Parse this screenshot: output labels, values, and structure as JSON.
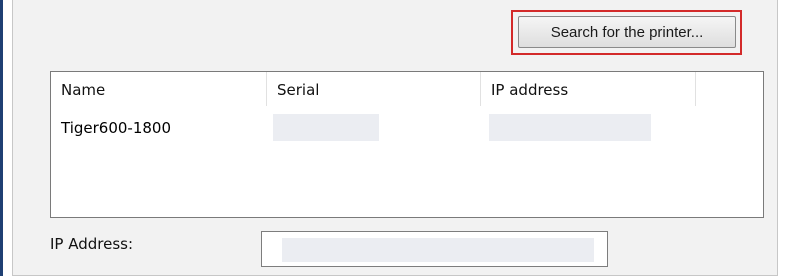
{
  "search_button": {
    "label": "Search for the printer..."
  },
  "printer_list": {
    "columns": [
      "Name",
      "Serial",
      "IP address"
    ],
    "rows": [
      {
        "name": "Tiger600-1800",
        "serial": "",
        "ip_address": ""
      }
    ]
  },
  "ip_field": {
    "label": "IP Address:",
    "value": ""
  },
  "colors": {
    "highlight": "#d32a2a",
    "panel": "#f2f2f2",
    "redaction": "#ebedf2"
  }
}
